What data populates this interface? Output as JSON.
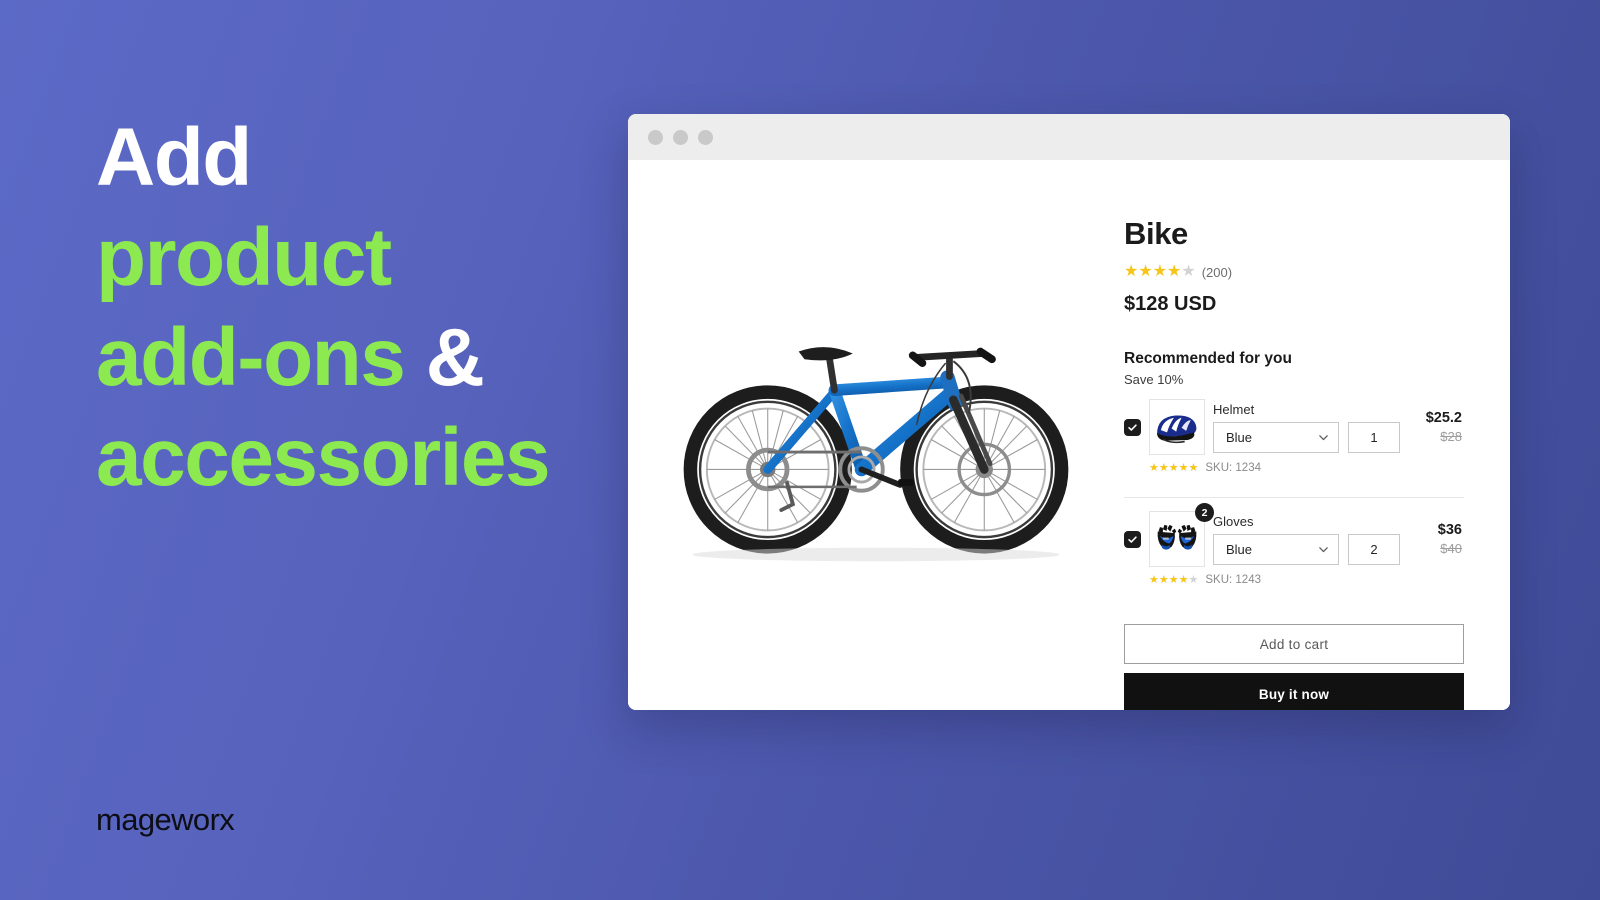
{
  "hero": {
    "lines": [
      {
        "text": "Add",
        "color": "white"
      },
      {
        "text": "product",
        "color": "green"
      },
      {
        "text": "add-ons ",
        "color": "green",
        "suffix": "&"
      },
      {
        "text": "accessories",
        "color": "green"
      }
    ],
    "line1": "Add",
    "line2": "product",
    "line3": "add-ons ",
    "line3_amp": "&",
    "line4": "accessories",
    "white_color": "#ffffff",
    "green_color": "#8ce94f"
  },
  "brand": {
    "logo_text": "mageworx"
  },
  "browser": {
    "dots": [
      "traffic-light-red",
      "traffic-light-yellow",
      "traffic-light-green"
    ],
    "dot_color": "#c9c9c9"
  },
  "product": {
    "gallery_image_alt": "blue mountain bike",
    "title": "Bike",
    "rating": 4,
    "rating_max": 5,
    "review_count": "(200)",
    "price": "$128 USD"
  },
  "recommendations": {
    "heading": "Recommended for you",
    "subheading": "Save 10%",
    "items": [
      {
        "name": "Helmet",
        "checked": true,
        "thumb": "helmet-thumbnail",
        "badge": "",
        "variant": "Blue",
        "quantity": "1",
        "price_new": "$25.2",
        "price_old": "$28",
        "rating": 5,
        "sku": "SKU: 1234"
      },
      {
        "name": "Gloves",
        "checked": true,
        "thumb": "gloves-thumbnail",
        "badge": "2",
        "variant": "Blue",
        "quantity": "2",
        "price_new": "$36",
        "price_old": "$40",
        "rating": 4,
        "sku": "SKU: 1243"
      }
    ]
  },
  "actions": {
    "add_to_cart": "Add to cart",
    "buy_it_now": "Buy it now"
  },
  "colors": {
    "background_start": "#5c6ac7",
    "background_end": "#3f4b96",
    "accent_green": "#8ce94f",
    "star_gold": "#f5c518",
    "star_off": "#d2d2d2",
    "primary_button": "#111111"
  }
}
